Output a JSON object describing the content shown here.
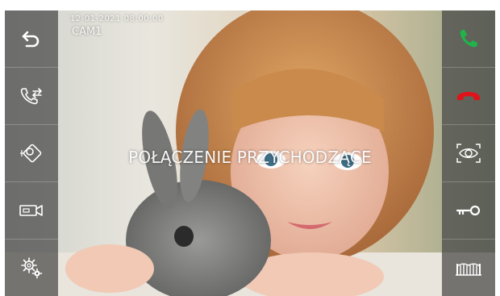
{
  "overlay": {
    "datetime": "12-01-2021  08:00:00",
    "camera": "CAM1",
    "status": "POŁĄCZENIE PRZYCHODZĄCE"
  },
  "left_panel": [
    {
      "name": "back",
      "icon": "back-arrow-icon"
    },
    {
      "name": "transfer-call",
      "icon": "call-transfer-icon"
    },
    {
      "name": "monitor",
      "icon": "camera-monitor-icon"
    },
    {
      "name": "video-record",
      "icon": "video-camera-icon"
    },
    {
      "name": "settings",
      "icon": "settings-gears-icon"
    }
  ],
  "right_panel": [
    {
      "name": "answer",
      "icon": "phone-answer-icon",
      "color": "#1fb34a"
    },
    {
      "name": "hang-up",
      "icon": "phone-hangup-icon",
      "color": "#e0121a"
    },
    {
      "name": "preview",
      "icon": "eye-icon"
    },
    {
      "name": "unlock",
      "icon": "key-icon"
    },
    {
      "name": "gate",
      "icon": "gate-icon"
    }
  ],
  "colors": {
    "panel": "#464646",
    "answer": "#1fb34a",
    "hangup": "#e0121a",
    "icon": "#ffffff"
  }
}
